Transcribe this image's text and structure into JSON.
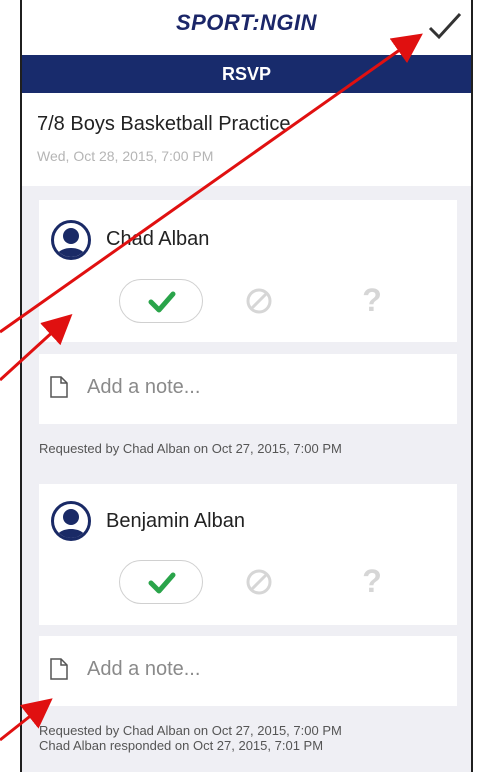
{
  "app": {
    "logo_text": "SPORT:NGIN",
    "screen_title": "RSVP",
    "confirm_icon": "checkmark-icon"
  },
  "event": {
    "title": "7/8 Boys Basketball Practice",
    "date": "Wed, Oct 28, 2015, 7:00 PM"
  },
  "attendees": [
    {
      "name": "Chad Alban",
      "selected_response": "yes",
      "note_placeholder": "Add a note...",
      "meta_lines": [
        "Requested by Chad Alban on Oct 27, 2015, 7:00 PM"
      ]
    },
    {
      "name": "Benjamin Alban",
      "selected_response": "yes",
      "note_placeholder": "Add a note...",
      "meta_lines": [
        "Requested by Chad Alban on Oct 27, 2015, 7:00 PM",
        "Chad Alban responded on Oct 27, 2015, 7:01 PM"
      ]
    }
  ],
  "response_icons": {
    "yes": "green-check-icon",
    "no": "no-entry-icon",
    "maybe": "question-mark-icon",
    "maybe_glyph": "?"
  },
  "colors": {
    "navbar": "#182b6c",
    "brand_text": "#1b2668",
    "check_green": "#2aa44a",
    "annotation_arrow": "#e01010",
    "background": "#efeff4"
  }
}
